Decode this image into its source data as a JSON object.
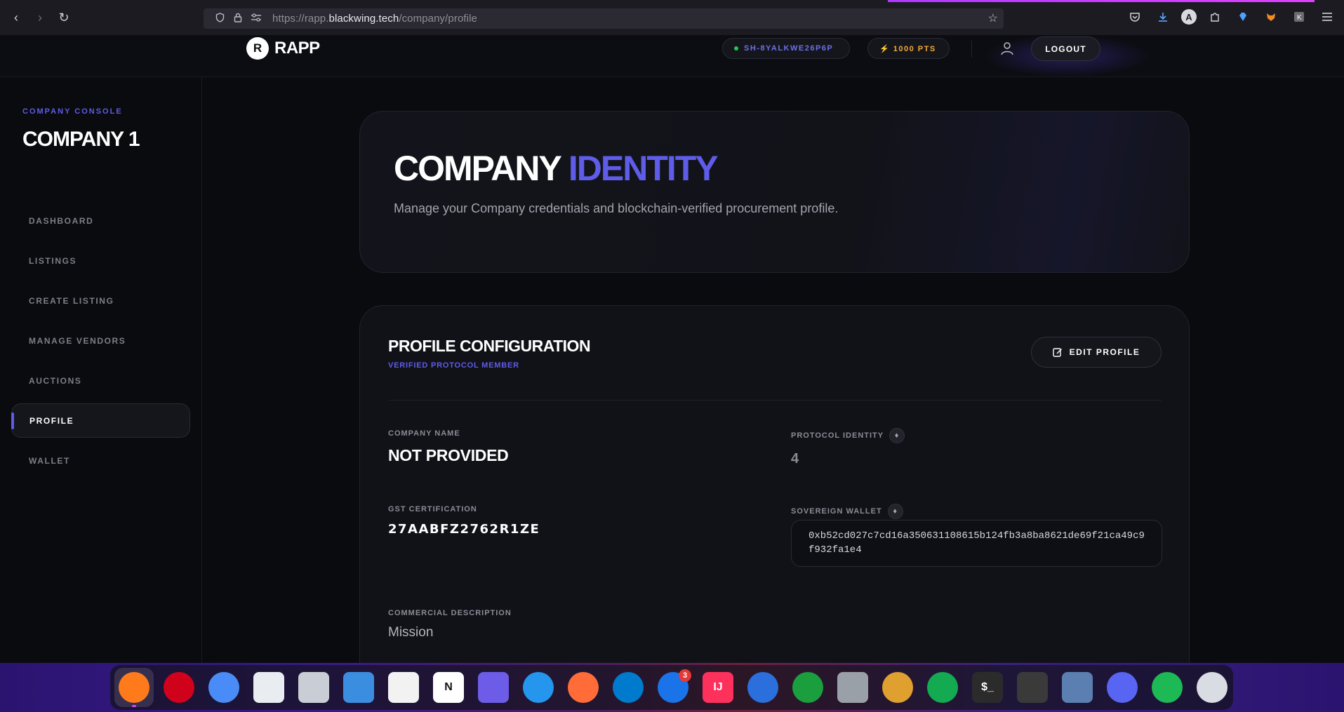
{
  "browser": {
    "url_prefix": "https://rapp.",
    "url_domain": "blackwing.tech",
    "url_path": "/company/profile",
    "back_icon": "‹",
    "forward_icon": "›",
    "reload_icon": "↻",
    "avatar_letter": "A"
  },
  "header": {
    "logo_letter": "R",
    "logo_text": "RAPP",
    "wallet_id": "SH-8YALKWE26P6P",
    "points": "⚡ 1000 PTS",
    "logout_label": "LOGOUT"
  },
  "sidebar": {
    "console_label": "COMPANY CONSOLE",
    "company_title": "COMPANY 1",
    "items": [
      {
        "label": "DASHBOARD"
      },
      {
        "label": "LISTINGS"
      },
      {
        "label": "CREATE LISTING"
      },
      {
        "label": "MANAGE VENDORS"
      },
      {
        "label": "AUCTIONS"
      },
      {
        "label": "PROFILE"
      },
      {
        "label": "WALLET"
      }
    ]
  },
  "hero": {
    "title_main": "COMPANY",
    "title_accent": "IDENTITY",
    "subtitle": "Manage your Company credentials and blockchain-verified procurement profile."
  },
  "config": {
    "title": "PROFILE CONFIGURATION",
    "subtitle": "VERIFIED PROTOCOL MEMBER",
    "edit_label": "EDIT PROFILE",
    "company_name_label": "COMPANY NAME",
    "company_name": "NOT PROVIDED",
    "protocol_identity_label": "PROTOCOL IDENTITY",
    "protocol_identity": "4",
    "gst_label": "GST CERTIFICATION",
    "gst_value": "27AABFZ2762R1ZE",
    "wallet_label": "SOVEREIGN WALLET",
    "wallet_address": "0xb52cd027c7cd16a350631108615b124fb3a8ba8621de69f21ca49c9f932fa1e4",
    "description_label": "COMMERCIAL DESCRIPTION",
    "description": "Mission"
  },
  "dock": {
    "apps": [
      {
        "name": "firefox",
        "color": "#ff7a1a"
      },
      {
        "name": "opera",
        "color": "#d0021b"
      },
      {
        "name": "chromium",
        "color": "#4a8cf7"
      },
      {
        "name": "files",
        "color": "#e9edf2"
      },
      {
        "name": "archive-manager",
        "color": "#c9ced6"
      },
      {
        "name": "document-viewer",
        "color": "#3b8de0"
      },
      {
        "name": "text-editor",
        "color": "#f2f2f2"
      },
      {
        "name": "notion",
        "label": "N",
        "color": "#ffffff"
      },
      {
        "name": "planner",
        "color": "#6c5ce7"
      },
      {
        "name": "docker",
        "color": "#2496ed"
      },
      {
        "name": "postman",
        "color": "#ff6c37"
      },
      {
        "name": "vscode",
        "color": "#007acc"
      },
      {
        "name": "android-studio",
        "color": "#1a73e8",
        "badge": "3"
      },
      {
        "name": "intellij",
        "label": "IJ",
        "color": "#fe315d"
      },
      {
        "name": "app-store",
        "color": "#2a6fdb"
      },
      {
        "name": "robo3t",
        "color": "#1b9e3e"
      },
      {
        "name": "unity",
        "color": "#9aa0a8"
      },
      {
        "name": "dbeaver",
        "color": "#e0a030"
      },
      {
        "name": "mongodb-compass",
        "color": "#13aa52"
      },
      {
        "name": "terminal",
        "label": "$_",
        "color": "#2b2b2b"
      },
      {
        "name": "toggle-app",
        "color": "#3a3a3a"
      },
      {
        "name": "system-monitor",
        "color": "#5a7fb0"
      },
      {
        "name": "discord",
        "color": "#5865f2"
      },
      {
        "name": "spotify",
        "color": "#1db954"
      },
      {
        "name": "trash",
        "color": "#d9dde3"
      }
    ]
  }
}
